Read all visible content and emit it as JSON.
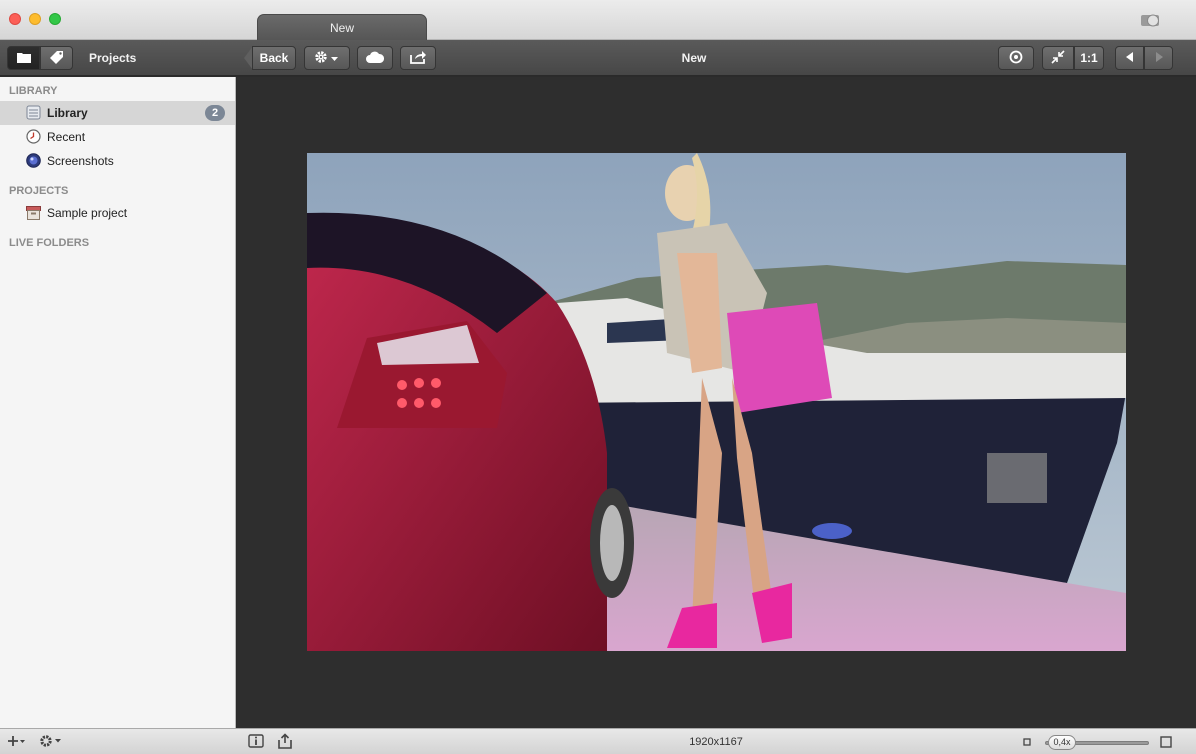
{
  "window": {
    "tab_title": "New"
  },
  "toolbar": {
    "projects_label": "Projects",
    "back_label": "Back",
    "title": "New",
    "one_to_one_label": "1:1"
  },
  "sidebar": {
    "sections": [
      {
        "heading": "LIBRARY"
      },
      {
        "heading": "PROJECTS"
      },
      {
        "heading": "LIVE FOLDERS"
      }
    ],
    "library_items": [
      {
        "label": "Library",
        "badge": "2",
        "icon": "library-icon"
      },
      {
        "label": "Recent",
        "icon": "clock-icon"
      },
      {
        "label": "Screenshots",
        "icon": "screenshots-icon"
      }
    ],
    "project_items": [
      {
        "label": "Sample project",
        "icon": "project-box-icon"
      }
    ]
  },
  "statusbar": {
    "dimensions": "1920x1167",
    "zoom_label": "0,4x",
    "zoom_fraction": 0.04
  },
  "colors": {
    "toolbar": "#4f4f4f",
    "viewer_bg": "#2e2e2e",
    "sidebar_bg": "#f5f5f5",
    "badge": "#7c8796"
  }
}
